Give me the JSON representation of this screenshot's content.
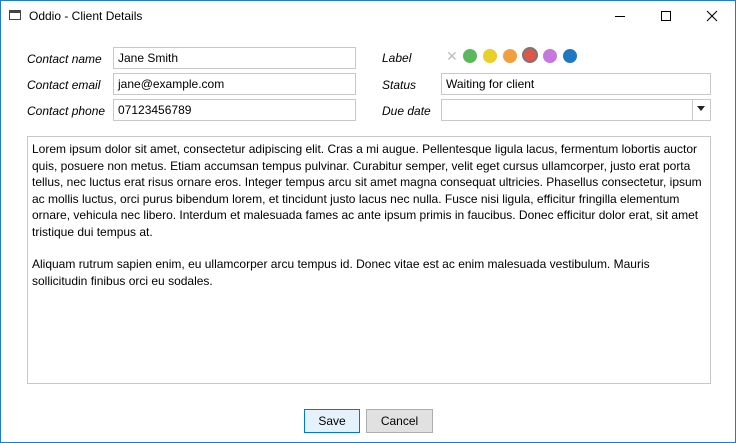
{
  "window": {
    "title": "Oddio - Client Details"
  },
  "form": {
    "contact_name_label": "Contact name",
    "contact_name_value": "Jane Smith",
    "contact_email_label": "Contact email",
    "contact_email_value": "jane@example.com",
    "contact_phone_label": "Contact phone",
    "contact_phone_value": "07123456789",
    "label_label": "Label",
    "status_label": "Status",
    "status_value": "Waiting for client",
    "due_date_label": "Due date",
    "due_date_value": ""
  },
  "label_colors": [
    {
      "name": "none",
      "glyph": "✕",
      "color": "#bdbdbd"
    },
    {
      "name": "green",
      "color": "#5cb85c"
    },
    {
      "name": "yellow",
      "color": "#e8cf2a"
    },
    {
      "name": "orange",
      "color": "#f0a040"
    },
    {
      "name": "red",
      "color": "#e0554a",
      "selected": true
    },
    {
      "name": "purple",
      "color": "#c678dd"
    },
    {
      "name": "blue",
      "color": "#1e78c2"
    }
  ],
  "notes": {
    "paragraph1": "Lorem ipsum dolor sit amet, consectetur adipiscing elit. Cras a mi augue. Pellentesque ligula lacus, fermentum lobortis auctor quis, posuere non metus. Etiam accumsan tempus pulvinar. Curabitur semper, velit eget cursus ullamcorper, justo erat porta tellus, nec luctus erat risus ornare eros. Integer tempus arcu sit amet magna consequat ultricies. Phasellus consectetur, ipsum ac mollis luctus, orci purus bibendum lorem, et tincidunt justo lacus nec nulla. Fusce nisi ligula, efficitur fringilla elementum ornare, vehicula nec libero. Interdum et malesuada fames ac ante ipsum primis in faucibus. Donec efficitur dolor erat, sit amet tristique dui tempus at.",
    "paragraph2": "Aliquam rutrum sapien enim, eu ullamcorper arcu tempus id. Donec vitae est ac enim malesuada vestibulum. Mauris sollicitudin finibus orci eu sodales."
  },
  "buttons": {
    "save": "Save",
    "cancel": "Cancel"
  }
}
